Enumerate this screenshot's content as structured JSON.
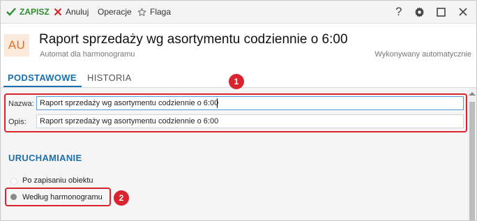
{
  "toolbar": {
    "save_label": "ZAPISZ",
    "cancel_label": "Anuluj",
    "operations_label": "Operacje",
    "flag_label": "Flaga",
    "help_label": "?"
  },
  "header": {
    "avatar_text": "AU",
    "title": "Raport sprzedaży wg asortymentu codziennie o 6:00",
    "subtitle": "Automat dla harmonogramu",
    "status": "Wykonywany automatycznie"
  },
  "tabs": [
    {
      "label": "PODSTAWOWE",
      "active": true
    },
    {
      "label": "HISTORIA",
      "active": false
    }
  ],
  "form": {
    "name_label": "Nazwa:",
    "name_value": "Raport sprzedaży wg asortymentu codziennie o 6:00",
    "description_label": "Opis:",
    "description_value": "Raport sprzedaży wg asortymentu codziennie o 6:00"
  },
  "run_section": {
    "title": "URUCHAMIANIE",
    "options": [
      {
        "label": "Po zapisaniu obiektu",
        "selected": false
      },
      {
        "label": "Według harmonogramu",
        "selected": true
      }
    ]
  },
  "callouts": [
    "1",
    "2"
  ],
  "colors": {
    "accent": "#1a70b0",
    "save_green": "#2e8b2e",
    "cancel_red": "#d9232e",
    "highlight_red": "#d9232e",
    "avatar_bg": "#fbe9dc",
    "avatar_fg": "#e07020"
  },
  "icons": [
    "check-icon",
    "x-icon",
    "star-icon",
    "help-icon",
    "gear-icon",
    "maximize-icon",
    "close-icon"
  ]
}
